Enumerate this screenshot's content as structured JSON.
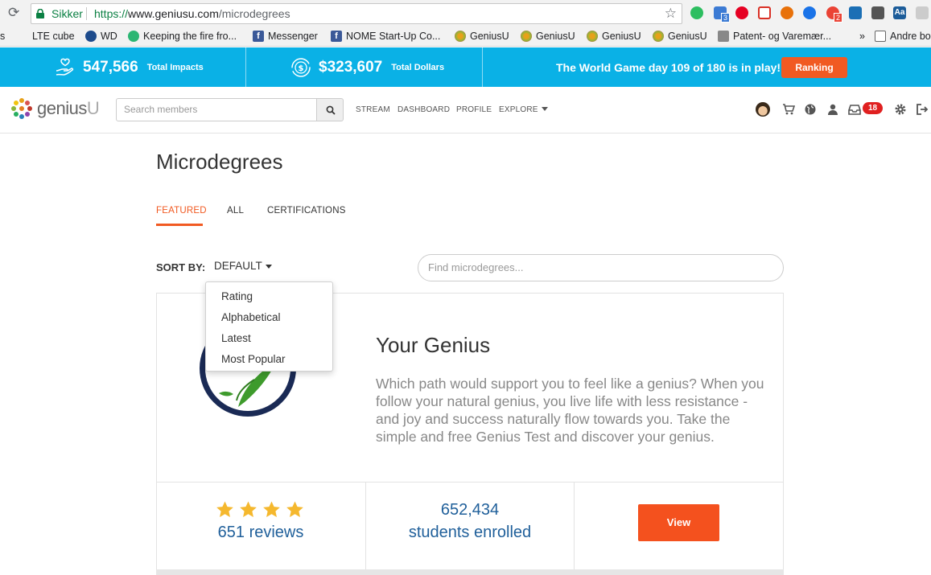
{
  "browser": {
    "secure_label": "Sikker",
    "url_scheme": "https://",
    "url_host": "www.geniusu.com",
    "url_path": "/microdegrees",
    "bookmarks": [
      {
        "label": "s"
      },
      {
        "label": "LTE cube"
      },
      {
        "label": "WD"
      },
      {
        "label": "Keeping the fire fro..."
      },
      {
        "label": "Messenger"
      },
      {
        "label": "NOME Start-Up Co..."
      },
      {
        "label": "GeniusU"
      },
      {
        "label": "GeniusU"
      },
      {
        "label": "GeniusU"
      },
      {
        "label": "GeniusU"
      },
      {
        "label": "Patent- og Varemær..."
      },
      {
        "label": "Andre bo"
      }
    ],
    "overflow_label": "»",
    "ext_badges": [
      "3",
      "2"
    ]
  },
  "impact_bar": {
    "impacts_value": "547,566",
    "impacts_label": "Total Impacts",
    "dollars_value": "$323,607",
    "dollars_label": "Total Dollars",
    "game_text": "The World Game day 109 of 180 is in play!",
    "ranking_label": "Ranking"
  },
  "header": {
    "logo_main": "genius",
    "logo_u": "U",
    "search_placeholder": "Search members",
    "nav": [
      "STREAM",
      "DASHBOARD",
      "PROFILE",
      "EXPLORE"
    ],
    "notification_count": "18"
  },
  "main": {
    "title": "Microdegrees",
    "tabs": [
      "FEATURED",
      "ALL",
      "CERTIFICATIONS"
    ],
    "sort_label": "SORT BY:",
    "sort_value": "DEFAULT",
    "find_placeholder": "Find microdegrees...",
    "sort_options": [
      "Rating",
      "Alphabetical",
      "Latest",
      "Most Popular"
    ]
  },
  "card": {
    "title": "Your Genius",
    "description": "Which path would support you to feel like a genius? When you follow your natural genius, you live life with less resistance - and joy and success naturally flow towards you. Take the simple and free Genius Test and discover your genius.",
    "rating": 4,
    "reviews": "651 reviews",
    "students_count": "652,434",
    "students_label": "students enrolled",
    "view_label": "View"
  },
  "colors": {
    "impact_bar": "#0ab1e6",
    "accent_orange": "#f15a22",
    "stat_blue": "#1f5f9a",
    "star_gold": "#f5b82e"
  }
}
